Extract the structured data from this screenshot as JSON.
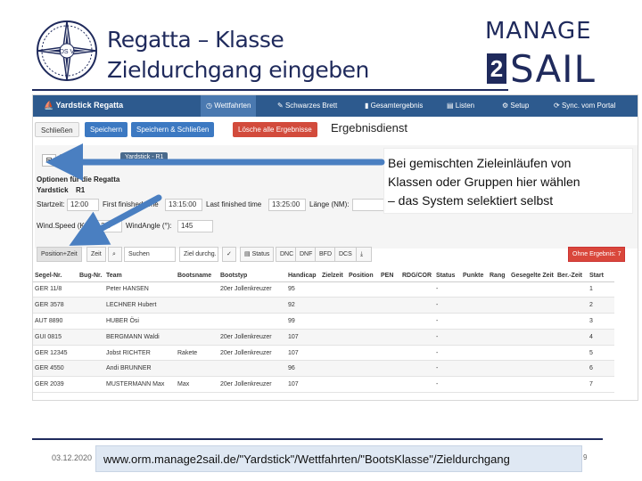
{
  "slide": {
    "title_line1": "Regatta – Klasse",
    "title_line2": "Zieldurchgang eingeben",
    "brand_top": "MANAGE",
    "brand_two": "2",
    "brand_bottom": "SAIL",
    "logo_letters": "DS V"
  },
  "app": {
    "brand": "Yardstick Regatta",
    "nav": [
      {
        "label": "Wettfahrten",
        "icon": "clock-icon",
        "active": true
      },
      {
        "label": "Schwarzes Brett",
        "icon": "pin-icon",
        "active": false
      },
      {
        "label": "Gesamtergebnis",
        "icon": "chart-icon",
        "active": false
      },
      {
        "label": "Listen",
        "icon": "list-icon",
        "active": false
      },
      {
        "label": "Setup",
        "icon": "gear-icon",
        "active": false
      },
      {
        "label": "Sync. vom Portal",
        "icon": "sync-icon",
        "active": false
      }
    ],
    "buttons": {
      "close": "Schließen",
      "save": "Speichern",
      "save_close": "Speichern & Schließen",
      "delete_results": "Lösche alle Ergebnisse"
    },
    "heading": "Ergebnisdienst",
    "tab": "Yardstick - R1",
    "panel": {
      "options_label": "Optionen für die Regatta",
      "class_label": "Yardstick",
      "race": "R1",
      "start_label": "Startzeit:",
      "start_value": "12:00",
      "first_finished_label": "First finished time",
      "first_finished_value": "13:15:00",
      "last_finished_label": "Last finished time",
      "last_finished_value": "13:25:00",
      "length_label": "Länge (NM):",
      "wind_speed_label": "Wind.Speed (Kn):",
      "wind_speed_value": "3,5",
      "wind_angle_label": "WindAngle (°):",
      "wind_angle_value": "145"
    },
    "toolbar": {
      "pos_zeit": "Position+Zeit",
      "zeit": "Zeit",
      "search_placeholder": "Suchen",
      "ziel_placeholder": "Ziel durchg.",
      "status": "Status",
      "dnc": "DNC",
      "dnf": "DNF",
      "bfd": "BFD",
      "dcs": "DCS",
      "ohne_ergebnis": "Ohne Ergebnis: 7"
    },
    "table": {
      "headers": [
        "Segel-Nr.",
        "Bug-Nr.",
        "Team",
        "Bootsname",
        "Bootstyp",
        "Handicap",
        "Zielzeit",
        "Position",
        "PEN",
        "RDG/COR",
        "Status",
        "Punkte",
        "Rang",
        "Gesegelte Zeit",
        "Ber.-Zeit",
        "Start"
      ],
      "rows": [
        [
          "GER 11/8",
          "",
          "Peter HANSEN",
          "",
          "20er Jollenkreuzer",
          "95",
          "",
          "",
          "",
          "",
          "-",
          "",
          "",
          "",
          "",
          "1"
        ],
        [
          "GER 3578",
          "",
          "LECHNER Hubert",
          "",
          "",
          "92",
          "",
          "",
          "",
          "",
          "-",
          "",
          "",
          "",
          "",
          "2"
        ],
        [
          "AUT 8890",
          "",
          "HUBER Ösi",
          "",
          "",
          "99",
          "",
          "",
          "",
          "",
          "-",
          "",
          "",
          "",
          "",
          "3"
        ],
        [
          "GUI 0815",
          "",
          "BERGMANN Waldi",
          "",
          "20er Jollenkreuzer",
          "107",
          "",
          "",
          "",
          "",
          "-",
          "",
          "",
          "",
          "",
          "4"
        ],
        [
          "GER 12345",
          "",
          "Jobst RICHTER",
          "Rakete",
          "20er Jollenkreuzer",
          "107",
          "",
          "",
          "",
          "",
          "-",
          "",
          "",
          "",
          "",
          "5"
        ],
        [
          "GER 4550",
          "",
          "Andi BRUNNER",
          "",
          "",
          "96",
          "",
          "",
          "",
          "",
          "-",
          "",
          "",
          "",
          "",
          "6"
        ],
        [
          "GER 2039",
          "",
          "MUSTERMANN Max",
          "Max",
          "20er Jollenkreuzer",
          "107",
          "",
          "",
          "",
          "",
          "-",
          "",
          "",
          "",
          "",
          "7"
        ]
      ]
    }
  },
  "callout": {
    "line1": "Bei gemischten Zieleinläufen von",
    "line2": "Klassen oder Gruppen hier wählen",
    "line3": "– das System selektiert selbst"
  },
  "footer": {
    "date": "03.12.2020",
    "url": "www.orm.manage2sail.de/\"Yardstick\"/Wettfahrten/\"BootsKlasse\"/Zieldurchgang",
    "page": "9"
  },
  "colors": {
    "navbar": "#2d5a8e",
    "primary_button": "#3c79c2",
    "danger_button": "#d24b3c",
    "title": "#1f2a5c",
    "arrow": "#4a7fc1"
  }
}
